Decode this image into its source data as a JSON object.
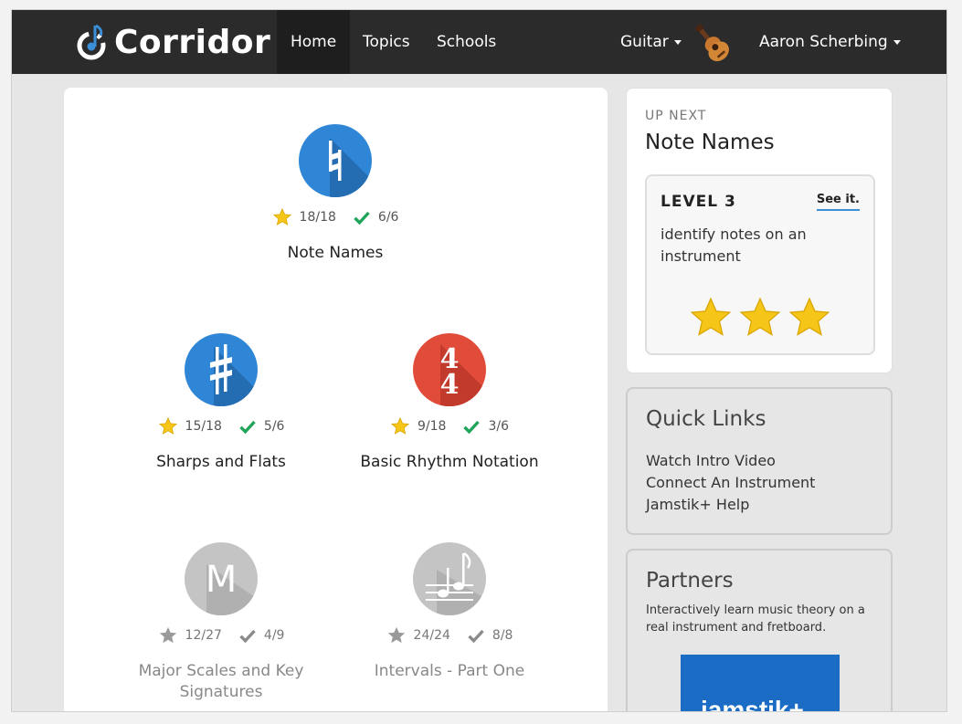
{
  "app": {
    "name": "Corridor"
  },
  "nav": {
    "items": [
      {
        "label": "Home",
        "active": true
      },
      {
        "label": "Topics"
      },
      {
        "label": "Schools"
      }
    ],
    "instrument": "Guitar",
    "user": "Aaron Scherbing"
  },
  "skills": [
    {
      "name": "Note Names",
      "icon": "natural-sign-icon",
      "color": "#2f86d6",
      "stars": "18/18",
      "checks": "6/6",
      "locked": false
    },
    {
      "name": "Sharps and Flats",
      "icon": "sharp-sign-icon",
      "color": "#2f86d6",
      "stars": "15/18",
      "checks": "5/6",
      "locked": false
    },
    {
      "name": "Basic Rhythm Notation",
      "icon": "time-signature-icon",
      "color": "#e04b3a",
      "stars": "9/18",
      "checks": "3/6",
      "locked": false
    },
    {
      "name": "Major Scales and Key Signatures",
      "icon": "m-letter-icon",
      "color": "#c4c4c4",
      "stars": "12/27",
      "checks": "4/9",
      "locked": true
    },
    {
      "name": "Intervals - Part One",
      "icon": "notes-icon",
      "color": "#c4c4c4",
      "stars": "24/24",
      "checks": "8/8",
      "locked": true
    }
  ],
  "up_next": {
    "label": "UP NEXT",
    "title": "Note Names",
    "level": "LEVEL 3",
    "see_it": "See it.",
    "description": "identify notes on an instrument",
    "stars": 3
  },
  "quick_links": {
    "title": "Quick Links",
    "links": [
      "Watch Intro Video",
      "Connect An Instrument",
      "Jamstik+ Help"
    ]
  },
  "partners": {
    "title": "Partners",
    "description": "Interactively learn music theory on a real instrument and fretboard.",
    "logo_text": "jamstik+"
  },
  "colors": {
    "topbar": "#2b2b2b",
    "blue": "#2f86d6",
    "red": "#e04b3a",
    "star": "#f5c518",
    "check": "#1fa45a"
  }
}
